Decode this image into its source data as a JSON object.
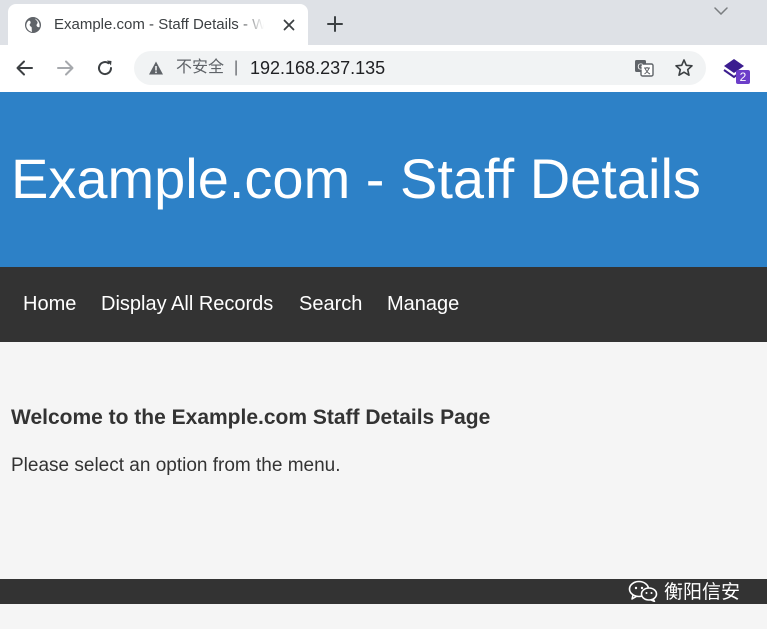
{
  "browser": {
    "tab": {
      "title": "Example.com - Staff Details - W"
    },
    "address_bar": {
      "security_label": "不安全",
      "separator": "|",
      "url": "192.168.237.135"
    },
    "extension": {
      "badge": "2"
    }
  },
  "site": {
    "header": {
      "title": "Example.com - Staff Details"
    },
    "nav": {
      "items": [
        {
          "label": "Home"
        },
        {
          "label": "Display All Records"
        },
        {
          "label": "Search"
        },
        {
          "label": "Manage"
        }
      ]
    },
    "main": {
      "heading": "Welcome to the Example.com Staff Details Page",
      "text": "Please select an option from the menu."
    }
  },
  "watermark": {
    "text": "衡阳信安"
  },
  "colors": {
    "header_bg": "#2d81c7",
    "nav_bg": "#333333",
    "page_bg": "#f5f5f5",
    "tabbar_bg": "#dee1e6"
  }
}
